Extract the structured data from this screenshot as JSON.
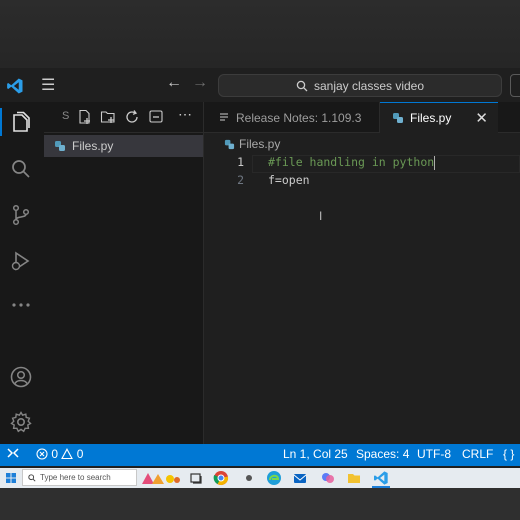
{
  "titlebar": {
    "command_center": "sanjay classes video"
  },
  "sidebar": {
    "toolbar_label": "S",
    "files": [
      {
        "name": "Files.py"
      }
    ]
  },
  "tabs": [
    {
      "label": "Release Notes: 1.109.3",
      "active": false
    },
    {
      "label": "Files.py",
      "active": true
    }
  ],
  "editor": {
    "breadcrumb": "Files.py",
    "lines": [
      {
        "number": "1",
        "text": "#file handling in python",
        "kind": "comment"
      },
      {
        "number": "2",
        "text": "f=open",
        "kind": "plain"
      }
    ]
  },
  "statusbar": {
    "errors": "0",
    "warnings": "0",
    "position": "Ln 1, Col 25",
    "spaces": "Spaces: 4",
    "encoding": "UTF-8",
    "eol": "CRLF",
    "language": "{ }"
  },
  "taskbar": {
    "search_placeholder": "Type here to search"
  },
  "colors": {
    "accent": "#0078d4",
    "python_icon": "#519aba",
    "comment": "#6a9955"
  },
  "icons": {
    "titlebar": [
      "vscode-logo-icon",
      "hamburger-menu-icon",
      "back-arrow-icon",
      "forward-arrow-icon",
      "search-icon"
    ],
    "activity": [
      "explorer-icon",
      "search-icon",
      "source-control-icon",
      "run-debug-icon",
      "more-icon",
      "account-icon",
      "settings-icon"
    ]
  }
}
